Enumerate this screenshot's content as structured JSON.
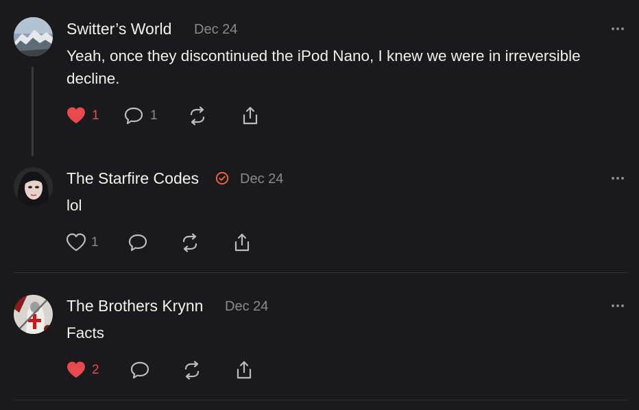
{
  "colors": {
    "background": "#1a1a1c",
    "like_red": "#e8494f",
    "verified_orange": "#ff6a2b",
    "muted": "#8a8a8e"
  },
  "posts": [
    {
      "author": "Switter’s World",
      "date": "Dec 24",
      "text": "Yeah, once they discontinued the iPod Nano, I knew we were in irreversible decline.",
      "likes": "1",
      "liked": true,
      "replies": "1",
      "avatar_icon": "mountain-avatar"
    },
    {
      "author": "The Starfire Codes",
      "verified": true,
      "date": "Dec 24",
      "text": "lol",
      "likes": "1",
      "liked": false,
      "replies": "",
      "avatar_icon": "woman-portrait-avatar"
    },
    {
      "author": "The Brothers Krynn",
      "date": "Dec 24",
      "text": "Facts",
      "likes": "2",
      "liked": true,
      "replies": "",
      "avatar_icon": "knight-avatar"
    }
  ]
}
